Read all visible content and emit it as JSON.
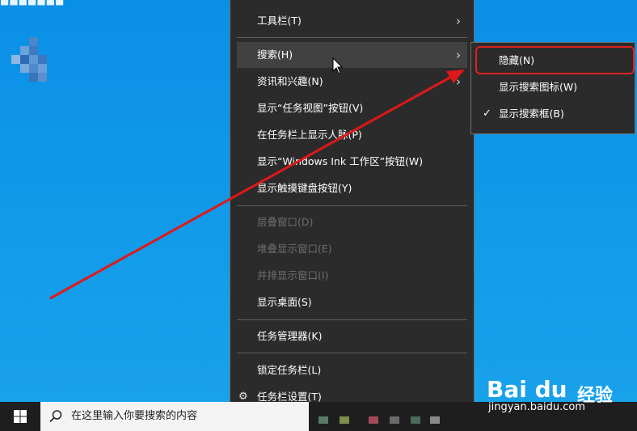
{
  "desktop": {
    "top_label": "■■■■■■■",
    "icon_pixels": [
      "#4a86c9",
      "#6aa3da",
      "#3f7bc0",
      "#8fb7e2",
      "#2d6bb5",
      "#5d97d5",
      "#3b78bd",
      "#7aaadc",
      "#4f8bcb",
      "#6b9fd7",
      "#3a74b9",
      "#5a90ce"
    ]
  },
  "context_menu": {
    "items": [
      {
        "label": "工具栏(T)",
        "submenu": true
      },
      {
        "label": "搜索(H)",
        "submenu": true,
        "hover": true
      },
      {
        "label": "资讯和兴趣(N)",
        "submenu": true
      },
      {
        "label": "显示“任务视图”按钮(V)"
      },
      {
        "label": "在任务栏上显示人脉(P)"
      },
      {
        "label": "显示“Windows Ink 工作区”按钮(W)"
      },
      {
        "label": "显示触摸键盘按钮(Y)"
      },
      {
        "label": "层叠窗口(D)",
        "disabled": true
      },
      {
        "label": "堆叠显示窗口(E)",
        "disabled": true
      },
      {
        "label": "并排显示窗口(I)",
        "disabled": true
      },
      {
        "label": "显示桌面(S)"
      },
      {
        "label": "任务管理器(K)"
      },
      {
        "label": "锁定任务栏(L)"
      },
      {
        "label": "任务栏设置(T)",
        "icon": "gear-icon"
      }
    ]
  },
  "submenu": {
    "items": [
      {
        "label": "隐藏(N)",
        "checked": false
      },
      {
        "label": "显示搜索图标(W)",
        "checked": false
      },
      {
        "label": "显示搜索框(B)",
        "checked": true
      }
    ]
  },
  "taskbar": {
    "search_placeholder": "在这里输入你要搜索的内容",
    "pinned_colors": [
      "#5a7a66",
      "#7d8f4a",
      "#a34a5a",
      "#6a6a6a",
      "#4a6a5a",
      "#8a8a8a"
    ]
  },
  "watermark": {
    "logo": "Bai du",
    "jingyan": "经验",
    "url": "jingyan.baidu.com"
  },
  "annotation": {
    "arrow_color": "#e01818",
    "highlight_color": "#e02020"
  }
}
